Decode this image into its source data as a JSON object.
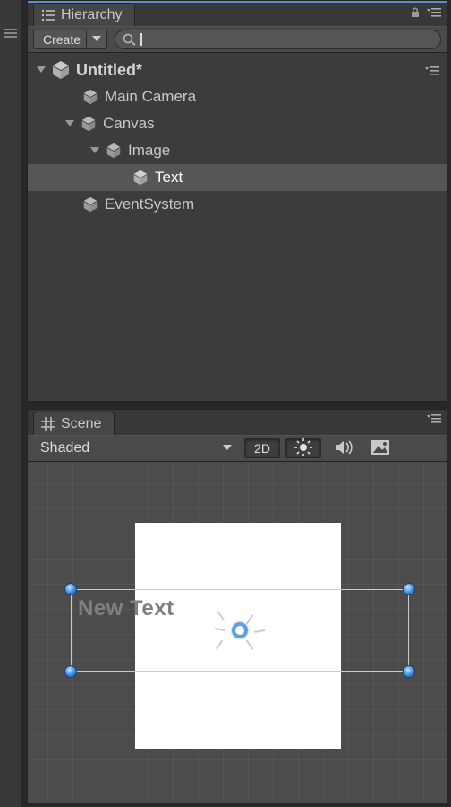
{
  "hierarchy": {
    "tab_label": "Hierarchy",
    "create_label": "Create",
    "search_placeholder": "",
    "scene_name": "Untitled*",
    "nodes": {
      "camera": "Main Camera",
      "canvas": "Canvas",
      "image": "Image",
      "text": "Text",
      "eventsystem": "EventSystem"
    }
  },
  "scene": {
    "tab_label": "Scene",
    "shading_mode": "Shaded",
    "button_2d": "2D",
    "canvas_text": "New Text"
  }
}
